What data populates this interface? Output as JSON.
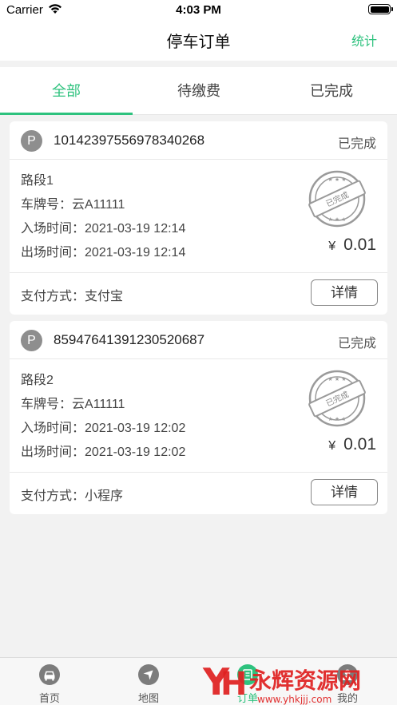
{
  "status_bar": {
    "carrier": "Carrier",
    "time": "4:03 PM"
  },
  "nav": {
    "title": "停车订单",
    "right_action": "统计"
  },
  "tabs": [
    {
      "label": "全部",
      "active": true
    },
    {
      "label": "待缴费",
      "active": false
    },
    {
      "label": "已完成",
      "active": false
    }
  ],
  "orders": [
    {
      "order_no": "10142397556978340268",
      "status": "已完成",
      "road": "路段1",
      "plate_label": "车牌号：",
      "plate": "云A11111",
      "entry_label": "入场时间：",
      "entry_time": "2021-03-19 12:14",
      "exit_label": "出场时间：",
      "exit_time": "2021-03-19 12:14",
      "currency": "¥",
      "amount": "0.01",
      "pay_label": "支付方式：",
      "pay_method": "支付宝",
      "detail_label": "详情",
      "stamp_text": "已完成"
    },
    {
      "order_no": "85947641391230520687",
      "status": "已完成",
      "road": "路段2",
      "plate_label": "车牌号：",
      "plate": "云A11111",
      "entry_label": "入场时间：",
      "entry_time": "2021-03-19 12:02",
      "exit_label": "出场时间：",
      "exit_time": "2021-03-19 12:02",
      "currency": "¥",
      "amount": "0.01",
      "pay_label": "支付方式：",
      "pay_method": "小程序",
      "detail_label": "详情",
      "stamp_text": "已完成"
    }
  ],
  "bottom_tabs": [
    {
      "label": "首页",
      "icon": "car-icon",
      "active": false
    },
    {
      "label": "地图",
      "icon": "navigation-icon",
      "active": false
    },
    {
      "label": "订单",
      "icon": "order-icon",
      "active": true
    },
    {
      "label": "我的",
      "icon": "user-icon",
      "active": false
    }
  ],
  "watermark": {
    "brand": "永辉资源网",
    "url": "www.yhkjjj.com"
  },
  "colors": {
    "accent": "#2ec27e",
    "stamp": "#9a9a9a",
    "background": "#f2f2f2"
  }
}
